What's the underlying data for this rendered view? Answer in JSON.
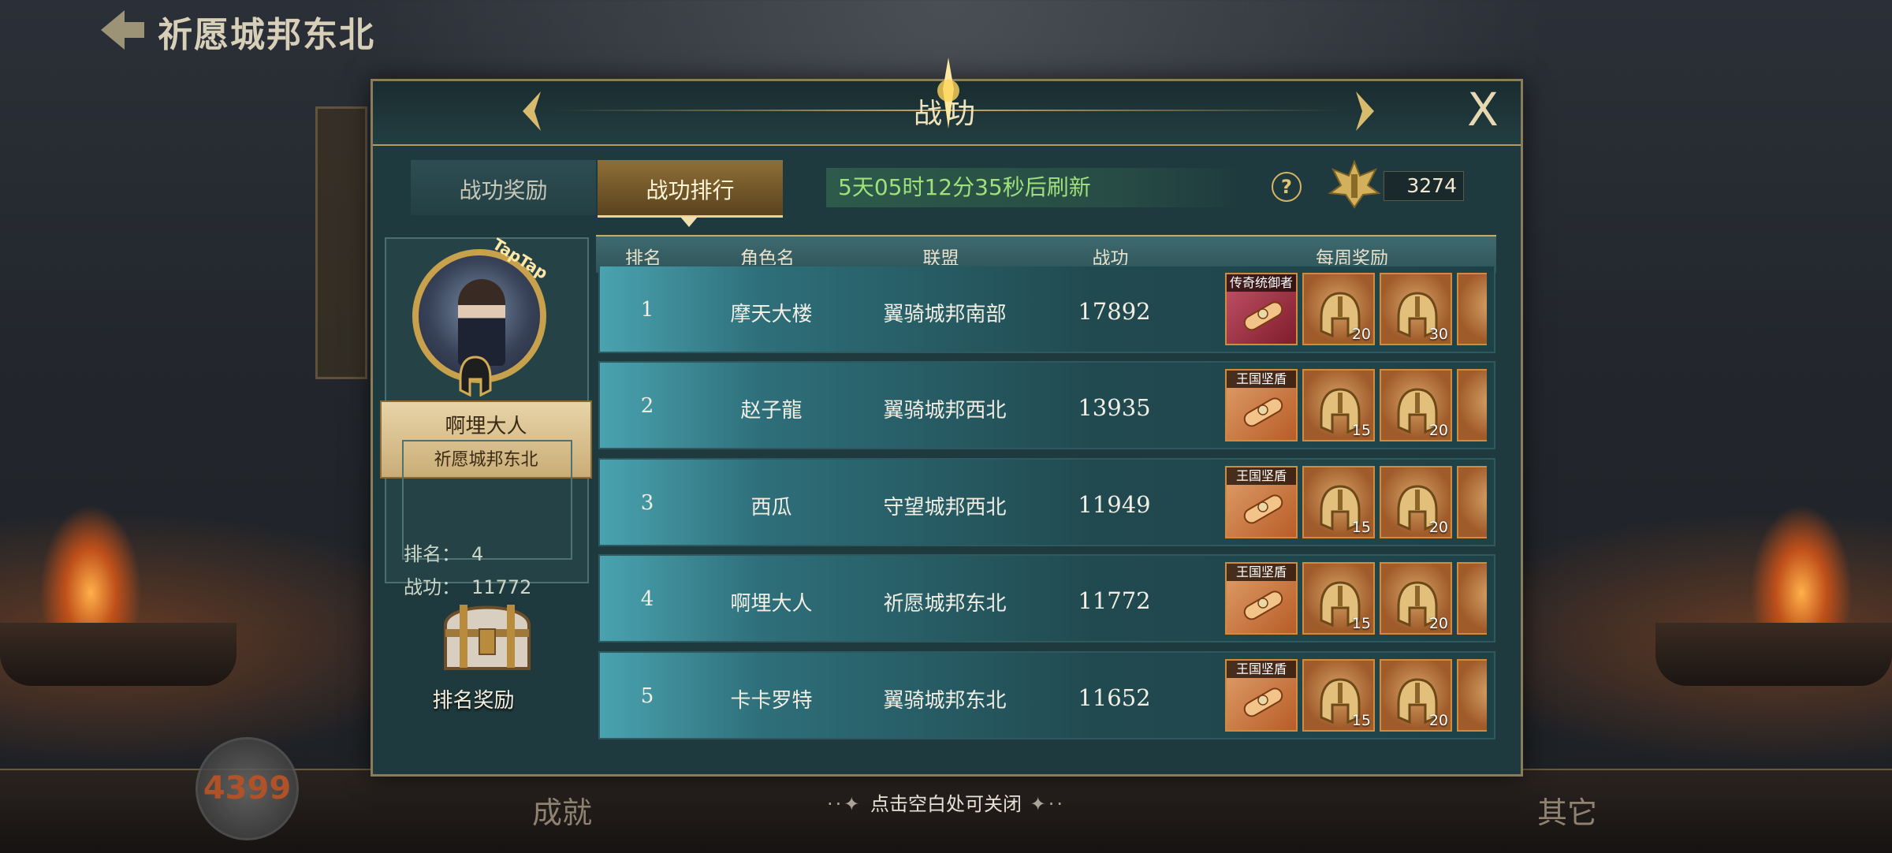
{
  "background": {
    "location_title": "祈愿城邦东北",
    "avatar_watermark": "4399",
    "bottom_items": [
      "成就",
      "其它"
    ]
  },
  "dialog": {
    "title": "战功",
    "close_label": "X",
    "tabs": [
      {
        "label": "战功奖励",
        "selected": false
      },
      {
        "label": "战功排行",
        "selected": true
      }
    ],
    "refresh_text": "5天05时12分35秒后刷新",
    "help_label": "?",
    "score": "3274"
  },
  "profile": {
    "avatar_tag": "TapTap",
    "name": "啊埋大人",
    "alliance": "祈愿城邦东北",
    "rank_label": "排名：",
    "rank_value": "4",
    "score_label": "战功：",
    "score_value": "11772",
    "rank_reward_label": "排名奖励"
  },
  "table": {
    "headers": [
      "排名",
      "角色名",
      "联盟",
      "战功",
      "每周奖励"
    ],
    "rows": [
      {
        "rank": "1",
        "name": "摩天大楼",
        "alliance": "翼骑城邦南部",
        "score": "17892",
        "rewards": [
          {
            "tag": "传奇统御者",
            "count": ""
          },
          {
            "tag": "",
            "count": "20"
          },
          {
            "tag": "",
            "count": "30"
          }
        ]
      },
      {
        "rank": "2",
        "name": "赵子龍",
        "alliance": "翼骑城邦西北",
        "score": "13935",
        "rewards": [
          {
            "tag": "王国坚盾",
            "count": ""
          },
          {
            "tag": "",
            "count": "15"
          },
          {
            "tag": "",
            "count": "20"
          }
        ]
      },
      {
        "rank": "3",
        "name": "西瓜",
        "alliance": "守望城邦西北",
        "score": "11949",
        "rewards": [
          {
            "tag": "王国坚盾",
            "count": ""
          },
          {
            "tag": "",
            "count": "15"
          },
          {
            "tag": "",
            "count": "20"
          }
        ]
      },
      {
        "rank": "4",
        "name": "啊埋大人",
        "alliance": "祈愿城邦东北",
        "score": "11772",
        "rewards": [
          {
            "tag": "王国坚盾",
            "count": ""
          },
          {
            "tag": "",
            "count": "15"
          },
          {
            "tag": "",
            "count": "20"
          }
        ]
      },
      {
        "rank": "5",
        "name": "卡卡罗特",
        "alliance": "翼骑城邦东北",
        "score": "11652",
        "rewards": [
          {
            "tag": "王国坚盾",
            "count": ""
          },
          {
            "tag": "",
            "count": "15"
          },
          {
            "tag": "",
            "count": "20"
          }
        ]
      }
    ]
  },
  "close_hint": "点击空白处可关闭"
}
